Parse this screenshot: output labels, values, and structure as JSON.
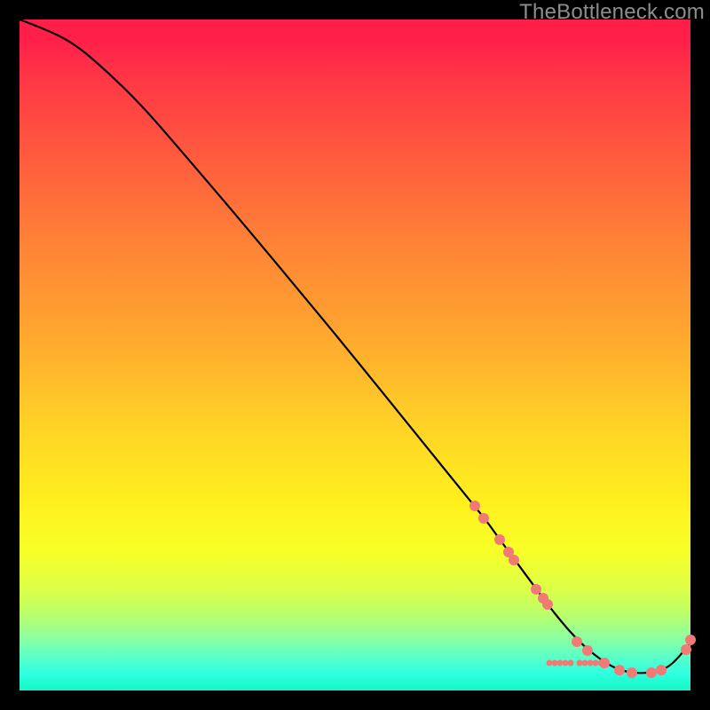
{
  "watermark": "TheBottleneck.com",
  "colors": {
    "marker": "#f17a76",
    "curve": "#000000"
  },
  "chart_data": {
    "type": "line",
    "title": "",
    "xlabel": "",
    "ylabel": "",
    "xlim": [
      0,
      100
    ],
    "ylim": [
      0,
      100
    ],
    "note": "Axes are unlabeled; values are percent positions within the 756×756 plot area estimated from the image.",
    "series": [
      {
        "name": "curve",
        "x": [
          0,
          4,
          8,
          12,
          18,
          26,
          34,
          42,
          50,
          58,
          66,
          69.5,
          71,
          73,
          76,
          80,
          84,
          88,
          91,
          94,
          96.5,
          98.2,
          100
        ],
        "y": [
          100,
          98.5,
          96.5,
          93.2,
          87.5,
          78.2,
          68.8,
          59.2,
          49.5,
          39.6,
          29.7,
          25.4,
          23.3,
          20.6,
          16.5,
          11.1,
          6.6,
          3.6,
          2.6,
          2.6,
          3.3,
          4.9,
          7.1
        ]
      }
    ],
    "markers_big": [
      {
        "x": 67.8,
        "y": 27.5
      },
      {
        "x": 69.2,
        "y": 25.7
      },
      {
        "x": 71.6,
        "y": 22.5
      },
      {
        "x": 72.9,
        "y": 20.6
      },
      {
        "x": 73.7,
        "y": 19.4
      },
      {
        "x": 77.0,
        "y": 15.1
      },
      {
        "x": 78.0,
        "y": 13.8
      },
      {
        "x": 78.7,
        "y": 12.8
      },
      {
        "x": 83.1,
        "y": 7.3
      },
      {
        "x": 84.7,
        "y": 5.9
      },
      {
        "x": 87.2,
        "y": 4.1
      },
      {
        "x": 89.4,
        "y": 3.0
      },
      {
        "x": 91.3,
        "y": 2.6
      },
      {
        "x": 94.2,
        "y": 2.6
      },
      {
        "x": 95.6,
        "y": 3.0
      },
      {
        "x": 99.3,
        "y": 6.1
      },
      {
        "x": 100.0,
        "y": 7.5
      }
    ],
    "markers_small": [
      {
        "x": 79.0,
        "y": 4.1
      },
      {
        "x": 79.8,
        "y": 4.1
      },
      {
        "x": 80.6,
        "y": 4.1
      },
      {
        "x": 81.4,
        "y": 4.1
      },
      {
        "x": 82.2,
        "y": 4.1
      },
      {
        "x": 83.4,
        "y": 4.1
      },
      {
        "x": 84.2,
        "y": 4.1
      },
      {
        "x": 85.0,
        "y": 4.1
      },
      {
        "x": 85.8,
        "y": 4.1
      },
      {
        "x": 86.6,
        "y": 4.1
      }
    ]
  }
}
